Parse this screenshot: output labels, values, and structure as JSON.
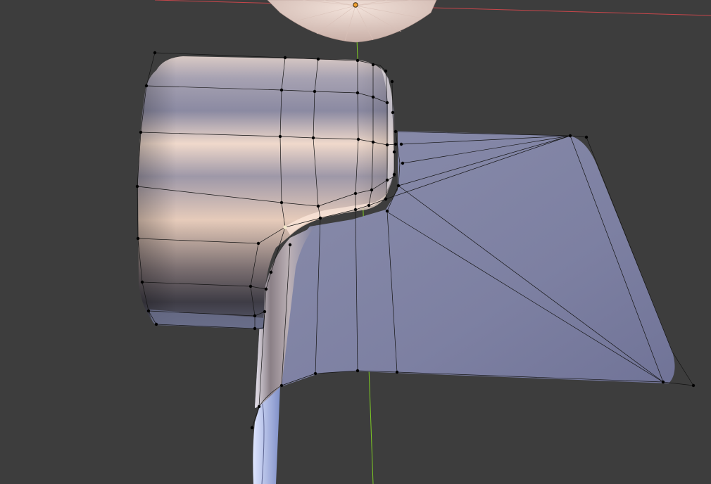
{
  "app": "3D Viewport",
  "viewport": {
    "background": "#3d3d3d",
    "axis_x_color": "#c8464b",
    "axis_y_color": "#7ecb24",
    "mesh_color": "#8c8fb0",
    "wire_color": "#111111",
    "origin_color": "#f0a030"
  }
}
